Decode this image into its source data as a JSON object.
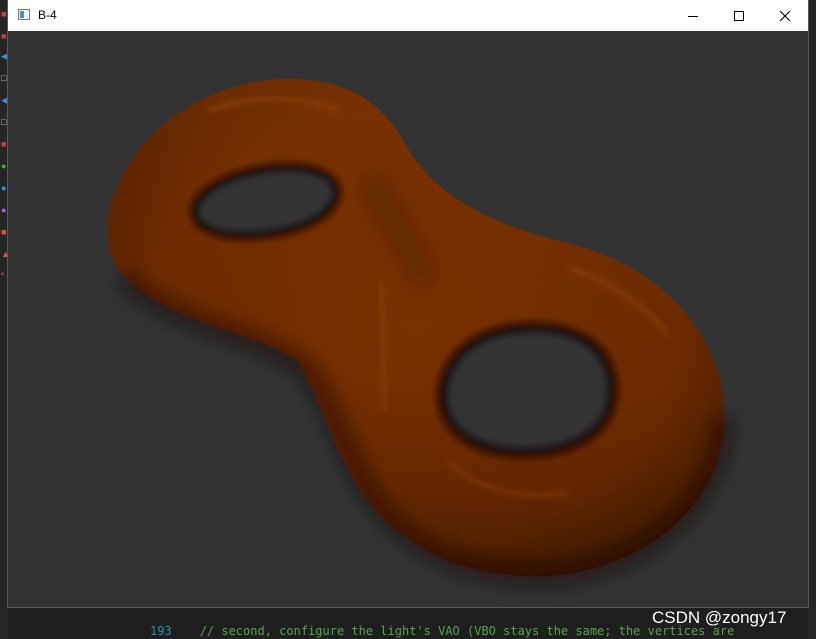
{
  "window": {
    "title": "B-4",
    "buttons": {
      "minimize": "minimize-icon",
      "maximize": "maximize-icon",
      "close": "close-icon"
    }
  },
  "scene": {
    "object": "double-torus",
    "surface_color": "#7a3000",
    "background_color": "#333333"
  },
  "background_editor": {
    "line_number": "193",
    "code_line": "// second, configure the light's VAO (VBO stays the same; the vertices are"
  },
  "watermark": "CSDN @zongy17"
}
